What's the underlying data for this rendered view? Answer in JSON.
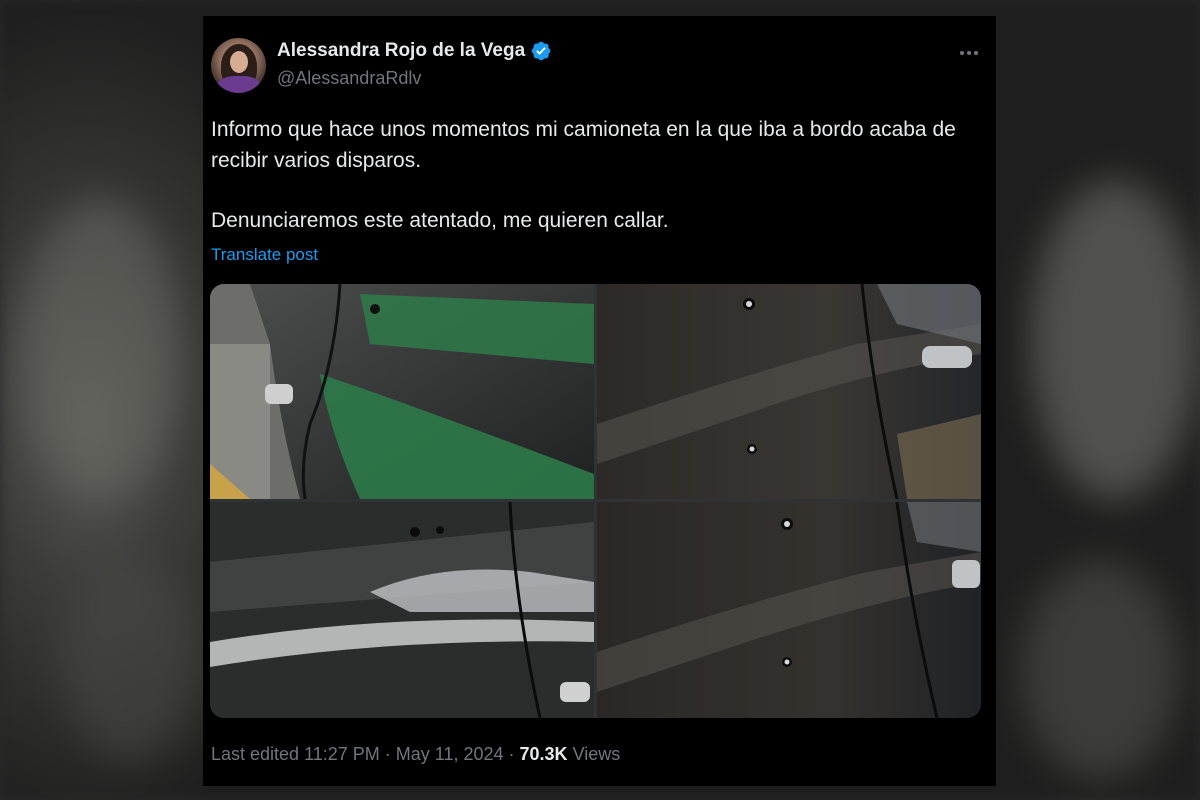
{
  "post": {
    "author_name": "Alessandra Rojo de la Vega",
    "handle": "@AlessandraRdlv",
    "verified": true,
    "text_line1": "Informo que hace unos momentos mi camioneta en la que iba a bordo acaba de recibir varios disparos.",
    "text_line2": "Denunciaremos este atentado, me quieren callar.",
    "translate_label": "Translate post",
    "edited_label": "Last edited 11:27 PM · May 11, 2024 · ",
    "views_count": "70.3K",
    "views_label": " Views"
  },
  "colors": {
    "background": "#000000",
    "text": "#e7e9ea",
    "muted": "#71767b",
    "link": "#1d9bf0",
    "verified_badge": "#1d9bf0"
  },
  "icons": {
    "verified": "verified-badge-icon",
    "more": "more-options-icon"
  }
}
